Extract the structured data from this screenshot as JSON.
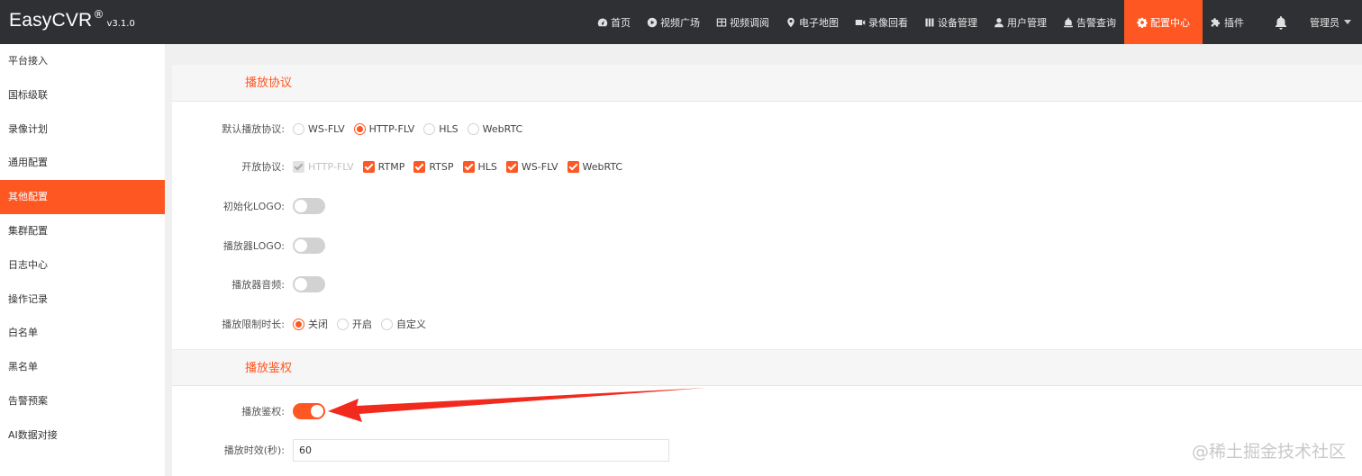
{
  "brand": {
    "name": "EasyCVR",
    "reg": "®",
    "version": "v3.1.0"
  },
  "nav": {
    "items": [
      {
        "label": "首页",
        "icon": "dashboard-icon"
      },
      {
        "label": "视频广场",
        "icon": "play-circle-icon"
      },
      {
        "label": "视频调阅",
        "icon": "grid-icon"
      },
      {
        "label": "电子地图",
        "icon": "map-pin-icon"
      },
      {
        "label": "录像回看",
        "icon": "video-camera-icon"
      },
      {
        "label": "设备管理",
        "icon": "device-icon"
      },
      {
        "label": "用户管理",
        "icon": "user-icon"
      },
      {
        "label": "告警查询",
        "icon": "alarm-icon"
      },
      {
        "label": "配置中心",
        "icon": "gear-icon"
      },
      {
        "label": "插件",
        "icon": "puzzle-icon"
      }
    ],
    "active": "配置中心",
    "user_label": "管理员"
  },
  "sidebar": {
    "items": [
      {
        "label": "平台接入"
      },
      {
        "label": "国标级联"
      },
      {
        "label": "录像计划"
      },
      {
        "label": "通用配置"
      },
      {
        "label": "其他配置"
      },
      {
        "label": "集群配置"
      },
      {
        "label": "日志中心"
      },
      {
        "label": "操作记录"
      },
      {
        "label": "白名单"
      },
      {
        "label": "黑名单"
      },
      {
        "label": "告警预案"
      },
      {
        "label": "AI数据对接"
      }
    ],
    "active": "其他配置"
  },
  "protocol_section": {
    "title": "播放协议",
    "default_protocol": {
      "label": "默认播放协议:",
      "options": [
        "WS-FLV",
        "HTTP-FLV",
        "HLS",
        "WebRTC"
      ],
      "selected": "HTTP-FLV"
    },
    "open_protocols": {
      "label": "开放协议:",
      "options": [
        {
          "label": "HTTP-FLV",
          "checked": true,
          "disabled": true
        },
        {
          "label": "RTMP",
          "checked": true,
          "disabled": false
        },
        {
          "label": "RTSP",
          "checked": true,
          "disabled": false
        },
        {
          "label": "HLS",
          "checked": true,
          "disabled": false
        },
        {
          "label": "WS-FLV",
          "checked": true,
          "disabled": false
        },
        {
          "label": "WebRTC",
          "checked": true,
          "disabled": false
        }
      ]
    },
    "init_logo": {
      "label": "初始化LOGO:",
      "on": false
    },
    "player_logo": {
      "label": "播放器LOGO:",
      "on": false
    },
    "player_audio": {
      "label": "播放器音频:",
      "on": false
    },
    "play_limit": {
      "label": "播放限制时长:",
      "options": [
        "关闭",
        "开启",
        "自定义"
      ],
      "selected": "关闭"
    }
  },
  "auth_section": {
    "title": "播放鉴权",
    "play_auth": {
      "label": "播放鉴权:",
      "on": true
    },
    "play_validity": {
      "label": "播放时效(秒):",
      "value": "60"
    }
  },
  "watermark": "@稀土掘金技术社区",
  "colors": {
    "accent": "#ff5722",
    "topbar": "#2f3033",
    "arrow": "#f22a1e"
  }
}
